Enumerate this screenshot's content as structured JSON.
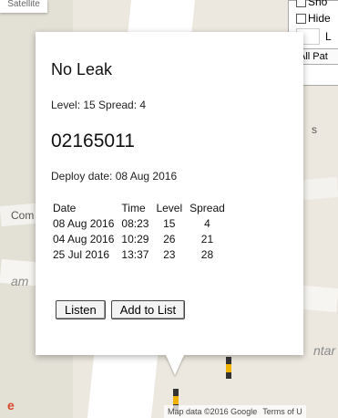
{
  "map": {
    "type_button": "Satellite",
    "labels": {
      "com": "Com",
      "am": "am",
      "ntar": "ntar",
      "side": "s"
    },
    "footer": {
      "map_data": "Map data ©2016 Google",
      "terms": "Terms of U"
    },
    "google_partial": "e"
  },
  "control": {
    "show_label": "Sho",
    "hide_label": "Hide",
    "input_label": "L",
    "select_value": "All Pat"
  },
  "info_window": {
    "title": "No Leak",
    "level_line": "Level: 15  Spread: 4",
    "serial": "02165011",
    "deploy_line": "Deploy date: 08 Aug 2016",
    "table": {
      "headers": [
        "Date",
        "Time",
        "Level",
        "Spread"
      ],
      "rows": [
        [
          "08 Aug 2016",
          "08:23",
          "15",
          "4"
        ],
        [
          "04 Aug 2016",
          "10:29",
          "26",
          "21"
        ],
        [
          "25 Jul 2016",
          "13:37",
          "23",
          "28"
        ]
      ]
    },
    "buttons": {
      "listen": "Listen",
      "add": "Add to List"
    }
  }
}
